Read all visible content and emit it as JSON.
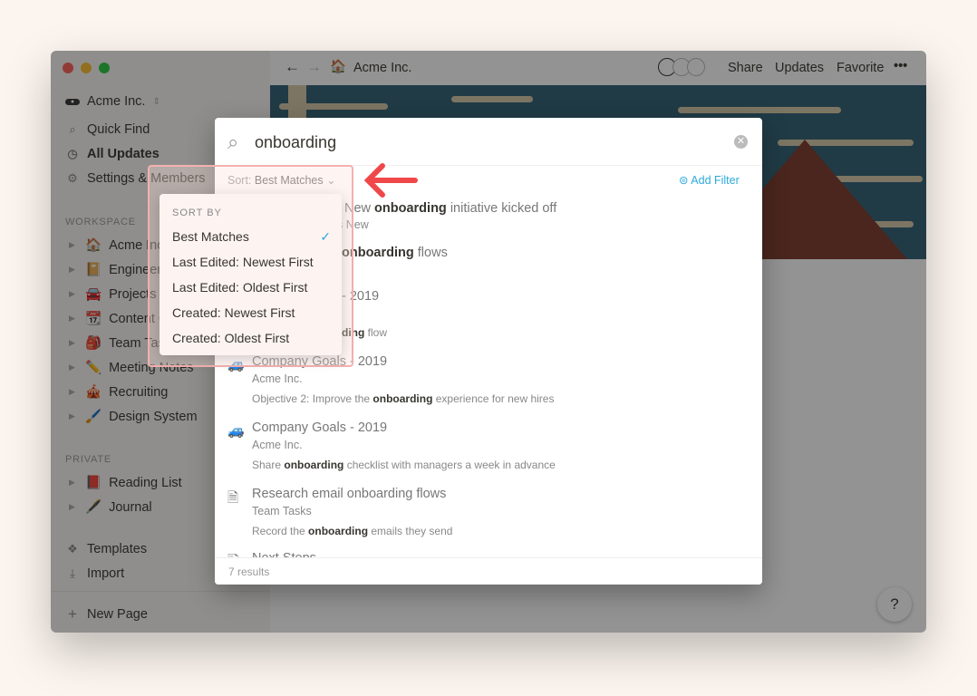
{
  "window": {
    "traffic_lights": [
      "#fe5f57",
      "#febc2e",
      "#28c840"
    ]
  },
  "sidebar": {
    "workspace_name": "Acme Inc.",
    "nav": [
      {
        "icon": "search-icon",
        "label": "Quick Find"
      },
      {
        "icon": "clock-icon",
        "label": "All Updates"
      },
      {
        "icon": "gear-icon",
        "label": "Settings & Members"
      }
    ],
    "workspace_label": "WORKSPACE",
    "workspace_pages": [
      {
        "emoji": "🏠",
        "label": "Acme Inc."
      },
      {
        "emoji": "📔",
        "label": "Engineering"
      },
      {
        "emoji": "🚘",
        "label": "Projects"
      },
      {
        "emoji": "📆",
        "label": "Content Calendar"
      },
      {
        "emoji": "🎒",
        "label": "Team Tasks"
      },
      {
        "emoji": "✏️",
        "label": "Meeting Notes"
      },
      {
        "emoji": "🎪",
        "label": "Recruiting"
      },
      {
        "emoji": "🖌️",
        "label": "Design System"
      }
    ],
    "private_label": "PRIVATE",
    "private_pages": [
      {
        "emoji": "📕",
        "label": "Reading List"
      },
      {
        "emoji": "🖋️",
        "label": "Journal"
      }
    ],
    "bottom": [
      {
        "icon": "templates-icon",
        "label": "Templates"
      },
      {
        "icon": "import-icon",
        "label": "Import"
      }
    ],
    "new_page": "New Page"
  },
  "topbar": {
    "breadcrumb_emoji": "🏠",
    "breadcrumb": "Acme Inc.",
    "share": "Share",
    "updates": "Updates",
    "favorite": "Favorite",
    "more": "•••"
  },
  "search": {
    "query": "onboarding",
    "sort_label": "Sort:",
    "sort_value": "Best Matches",
    "add_filter": "Add Filter",
    "count": "7 results"
  },
  "results": [
    {
      "title_visible": "New ",
      "title_bold": "onboarding",
      "title_after": " initiative kicked off",
      "sub_visible": "s New"
    },
    {
      "title_bold": "onboarding",
      "title_after": " flows"
    },
    {
      "title_after": "- 2019",
      "snippet_bold": "ding",
      "snippet_after": " flow"
    },
    {
      "emoji": "🚙",
      "title": "Company Goals - 2019",
      "sub": "Acme Inc.",
      "snippet_before": "Objective 2: Improve the ",
      "snippet_bold": "onboarding",
      "snippet_after": " experience for new hires"
    },
    {
      "emoji": "🚙",
      "title": "Company Goals - 2019",
      "sub": "Acme Inc.",
      "snippet_before": "Share ",
      "snippet_bold": "onboarding",
      "snippet_after": " checklist with managers a week in advance"
    },
    {
      "title": "Research email onboarding flows",
      "sub": "Team Tasks",
      "snippet_before": "Record the ",
      "snippet_bold": "onboarding",
      "snippet_after": " emails they send"
    },
    {
      "title": "Next Steps"
    }
  ],
  "sort_menu": {
    "heading": "SORT BY",
    "options": [
      "Best Matches",
      "Last Edited: Newest First",
      "Last Edited: Oldest First",
      "Created: Newest First",
      "Created: Oldest First"
    ],
    "selected": "Best Matches"
  },
  "help": "?",
  "colors": {
    "accent": "#2eaadc",
    "annotation": "#f0474a"
  }
}
